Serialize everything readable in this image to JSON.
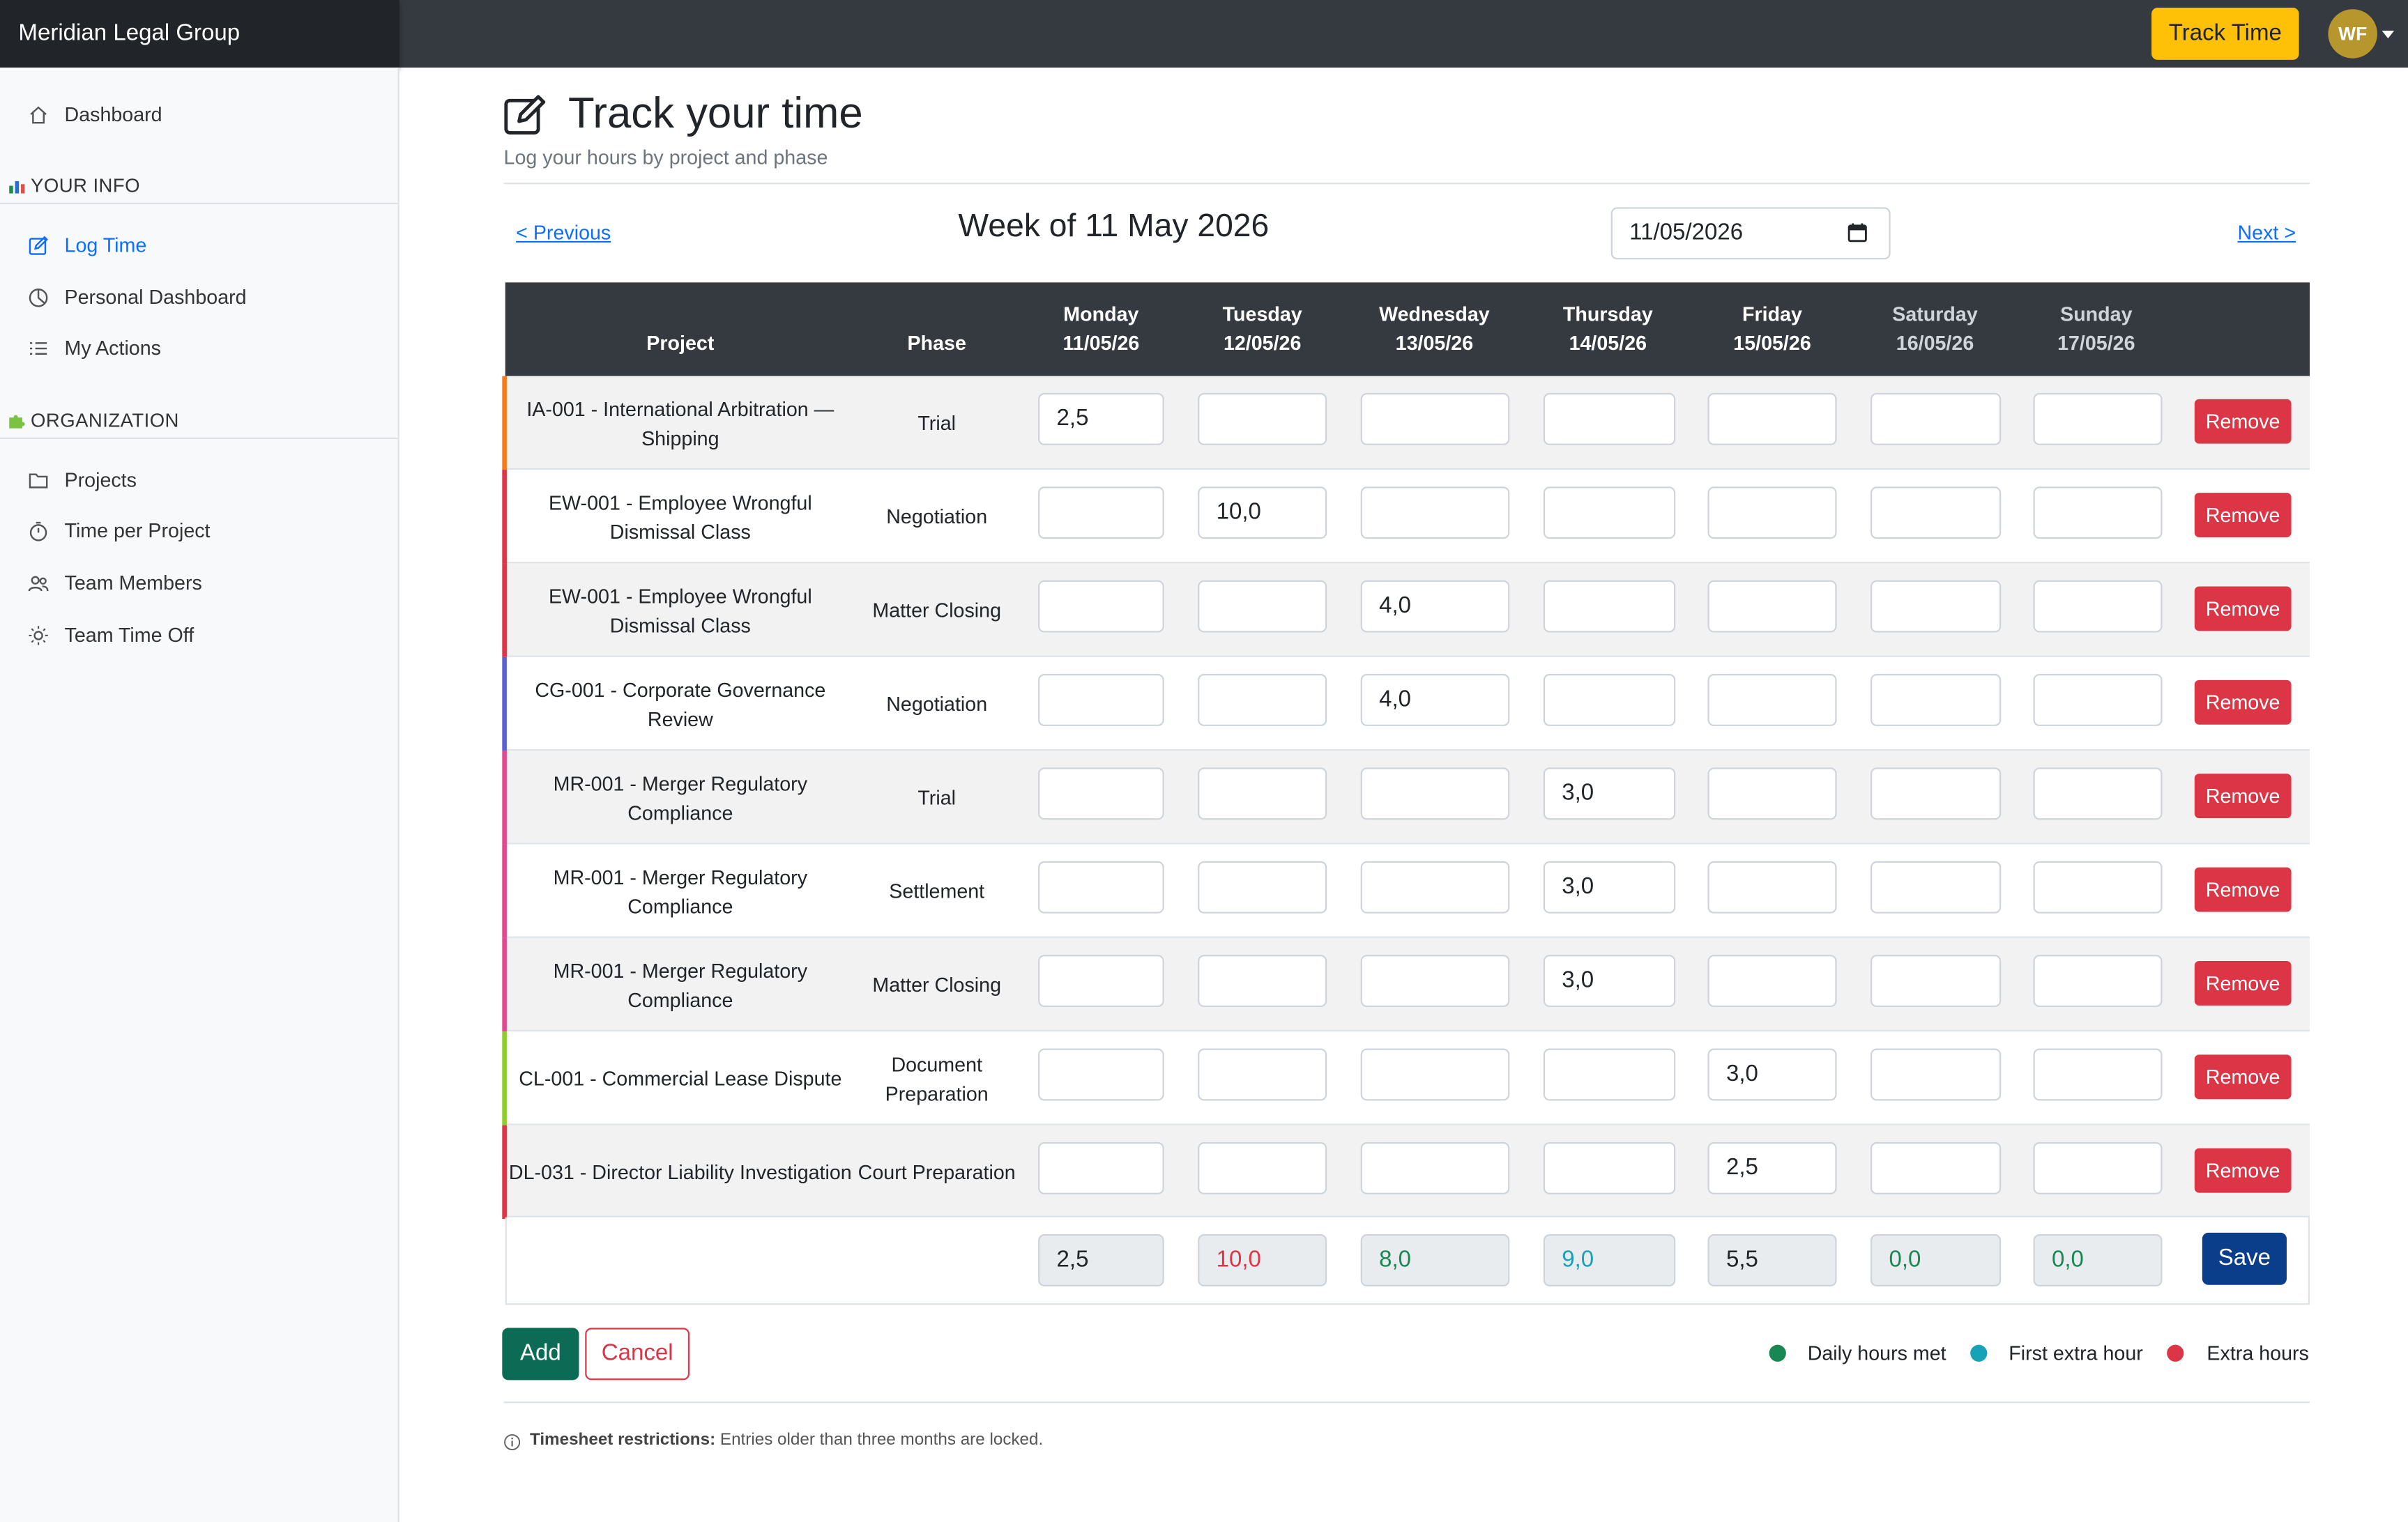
{
  "app": {
    "brand": "Meridian Legal Group",
    "track_time": "Track Time",
    "user_initials": "WF"
  },
  "sidebar": {
    "dashboard": "Dashboard",
    "section_your_info": "YOUR INFO",
    "log_time": "Log Time",
    "personal_dashboard": "Personal Dashboard",
    "my_actions": "My Actions",
    "section_organization": "ORGANIZATION",
    "projects": "Projects",
    "time_per_project": "Time per Project",
    "team_members": "Team Members",
    "team_time_off": "Team Time Off"
  },
  "header": {
    "title": "Track your time",
    "subtitle": "Log your hours by project and phase"
  },
  "week_nav": {
    "previous": "< Previous",
    "week_label": "Week of 11 May 2026",
    "date_value": "11/05/2026",
    "next": "Next >"
  },
  "table": {
    "col_project": "Project",
    "col_phase": "Phase",
    "days": [
      {
        "name": "Monday",
        "date": "11/05/26"
      },
      {
        "name": "Tuesday",
        "date": "12/05/26"
      },
      {
        "name": "Wednesday",
        "date": "13/05/26"
      },
      {
        "name": "Thursday",
        "date": "14/05/26"
      },
      {
        "name": "Friday",
        "date": "15/05/26"
      },
      {
        "name": "Saturday",
        "date": "16/05/26"
      },
      {
        "name": "Sunday",
        "date": "17/05/26"
      }
    ],
    "remove_label": "Remove",
    "rows": [
      {
        "project": "IA-001 - International Arbitration — Shipping",
        "phase": "Trial",
        "color": "#f47c20",
        "hours": [
          "2,5",
          "",
          "",
          "",
          "",
          "",
          ""
        ]
      },
      {
        "project": "EW-001 - Employee Wrongful Dismissal Class",
        "phase": "Negotiation",
        "color": "#dc3545",
        "hours": [
          "",
          "10,0",
          "",
          "",
          "",
          "",
          ""
        ]
      },
      {
        "project": "EW-001 - Employee Wrongful Dismissal Class",
        "phase": "Matter Closing",
        "color": "#dc3545",
        "hours": [
          "",
          "",
          "4,0",
          "",
          "",
          "",
          ""
        ]
      },
      {
        "project": "CG-001 - Corporate Governance Review",
        "phase": "Negotiation",
        "color": "#5b5fd6",
        "hours": [
          "",
          "",
          "4,0",
          "",
          "",
          "",
          ""
        ]
      },
      {
        "project": "MR-001 - Merger Regulatory Compliance",
        "phase": "Trial",
        "color": "#e0488f",
        "hours": [
          "",
          "",
          "",
          "3,0",
          "",
          "",
          ""
        ]
      },
      {
        "project": "MR-001 - Merger Regulatory Compliance",
        "phase": "Settlement",
        "color": "#e0488f",
        "hours": [
          "",
          "",
          "",
          "3,0",
          "",
          "",
          ""
        ]
      },
      {
        "project": "MR-001 - Merger Regulatory Compliance",
        "phase": "Matter Closing",
        "color": "#e0488f",
        "hours": [
          "",
          "",
          "",
          "3,0",
          "",
          "",
          ""
        ]
      },
      {
        "project": "CL-001 - Commercial Lease Dispute",
        "phase": "Document Preparation",
        "color": "#8ccf2c",
        "hours": [
          "",
          "",
          "",
          "",
          "3,0",
          "",
          ""
        ]
      },
      {
        "project": "DL-031 - Director Liability Investigation",
        "phase": "Court Preparation",
        "color": "#dc3545",
        "hours": [
          "",
          "",
          "",
          "",
          "2,5",
          "",
          ""
        ]
      }
    ],
    "totals": [
      {
        "value": "2,5",
        "color": "#212529"
      },
      {
        "value": "10,0",
        "color": "#dc3545"
      },
      {
        "value": "8,0",
        "color": "#198754"
      },
      {
        "value": "9,0",
        "color": "#17a2b8"
      },
      {
        "value": "5,5",
        "color": "#212529"
      },
      {
        "value": "0,0",
        "color": "#198754"
      },
      {
        "value": "0,0",
        "color": "#198754"
      }
    ],
    "save_label": "Save"
  },
  "actions": {
    "add": "Add",
    "cancel": "Cancel"
  },
  "legend": [
    {
      "label": "Daily hours met",
      "color": "#198754"
    },
    {
      "label": "First extra hour",
      "color": "#17a2b8"
    },
    {
      "label": "Extra hours",
      "color": "#dc3545"
    }
  ],
  "footer": {
    "restrictions_title": "Timesheet restrictions:",
    "restrictions_text": "Entries older than three months are locked."
  }
}
